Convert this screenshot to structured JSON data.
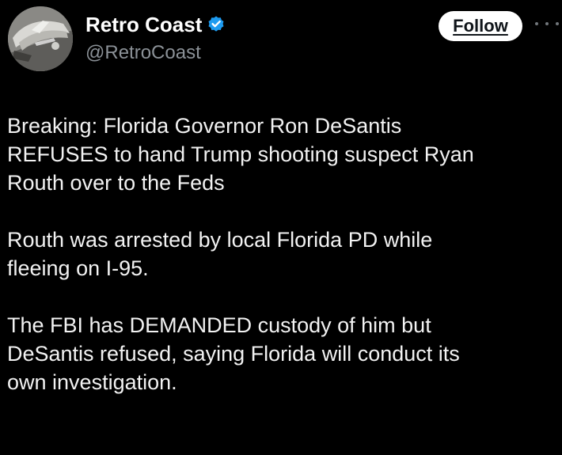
{
  "account": {
    "display_name": "Retro Coast",
    "handle": "@RetroCoast",
    "verified": true,
    "avatar_icon": "vintage-car-avatar"
  },
  "actions": {
    "follow_label": "Follow",
    "more_icon": "more-horizontal-icon"
  },
  "tweet": {
    "paragraphs": [
      {
        "lines": [
          "Breaking: Florida Governor Ron DeSantis",
          "REFUSES to hand Trump shooting suspect Ryan",
          "Routh over to the Feds"
        ]
      },
      {
        "lines": [
          "Routh was arrested by local Florida PD while",
          "fleeing on I-95."
        ]
      },
      {
        "lines": [
          "The FBI has DEMANDED custody of him but",
          "DeSantis refused, saying Florida will conduct its",
          "own investigation."
        ]
      }
    ]
  },
  "colors": {
    "background": "#000000",
    "text": "#f2f2f2",
    "muted": "#8b9197",
    "verified_badge": "#1d9bf0",
    "follow_bg": "#ffffff"
  }
}
